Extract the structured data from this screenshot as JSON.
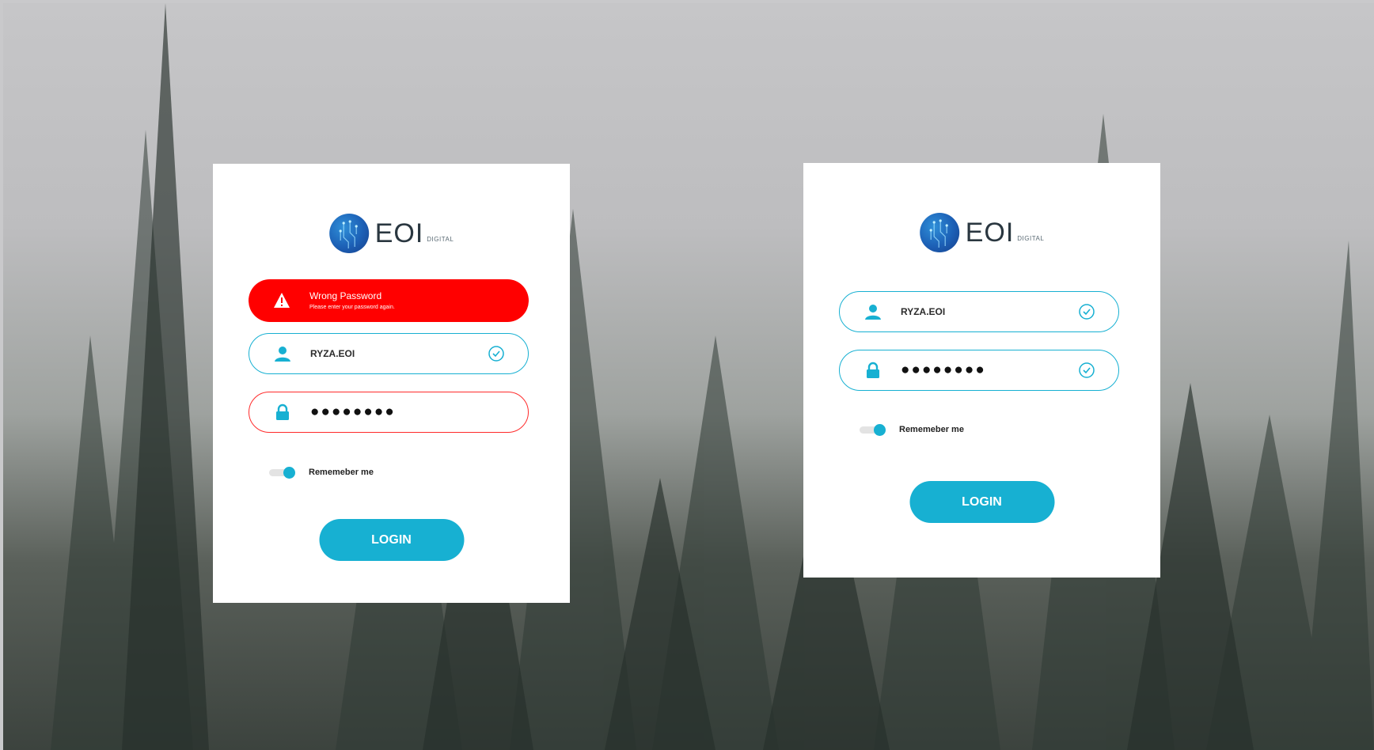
{
  "brand": {
    "name": "EOI",
    "sub": "DIGITAL"
  },
  "left_card": {
    "alert": {
      "title": "Wrong Password",
      "message": "Please enter your password again."
    },
    "username": "RYZA.EOI",
    "password_mask": "●●●●●●●●",
    "remember_label": "Rememeber me",
    "login_label": "LOGIN"
  },
  "right_card": {
    "username": "RYZA.EOI",
    "password_mask": "●●●●●●●●",
    "remember_label": "Rememeber me",
    "login_label": "LOGIN"
  },
  "colors": {
    "accent": "#17b0d2",
    "error": "#ff0000",
    "text": "#2a3740"
  },
  "icons": [
    "user-icon",
    "lock-icon",
    "check-circle-icon",
    "warning-icon"
  ]
}
